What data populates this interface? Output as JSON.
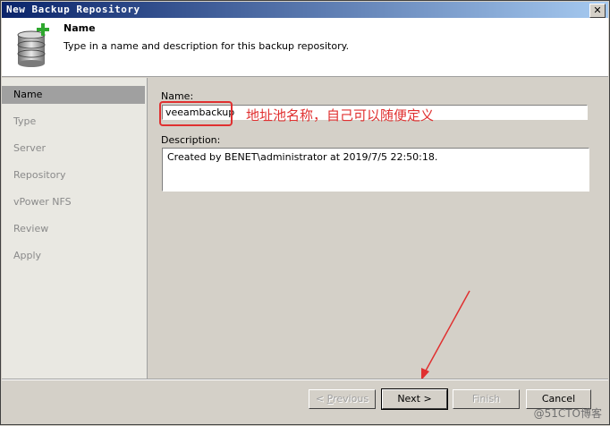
{
  "window": {
    "title": "New Backup Repository",
    "close_glyph": "✕"
  },
  "header": {
    "icon": "database-add-icon",
    "title": "Name",
    "description": "Type in a name and description for this backup repository."
  },
  "sidebar": {
    "items": [
      {
        "label": "Name",
        "active": true
      },
      {
        "label": "Type",
        "active": false
      },
      {
        "label": "Server",
        "active": false
      },
      {
        "label": "Repository",
        "active": false
      },
      {
        "label": "vPower NFS",
        "active": false
      },
      {
        "label": "Review",
        "active": false
      },
      {
        "label": "Apply",
        "active": false
      }
    ]
  },
  "form": {
    "name_label": "Name:",
    "name_value": "veeambackup",
    "description_label": "Description:",
    "description_value": "Created by BENET\\administrator at 2019/7/5 22:50:18."
  },
  "annotation": {
    "text": "地址池名称，自己可以随便定义",
    "color": "#e03030"
  },
  "buttons": {
    "previous": {
      "label": "Previous",
      "prefix": "< ",
      "mnemonic": "P",
      "enabled": false
    },
    "next": {
      "label": "Next >",
      "mnemonic": "N",
      "enabled": true
    },
    "finish": {
      "label": "Finish",
      "mnemonic": "F",
      "enabled": false
    },
    "cancel": {
      "label": "Cancel",
      "enabled": true
    }
  },
  "watermark": "@51CTO博客"
}
